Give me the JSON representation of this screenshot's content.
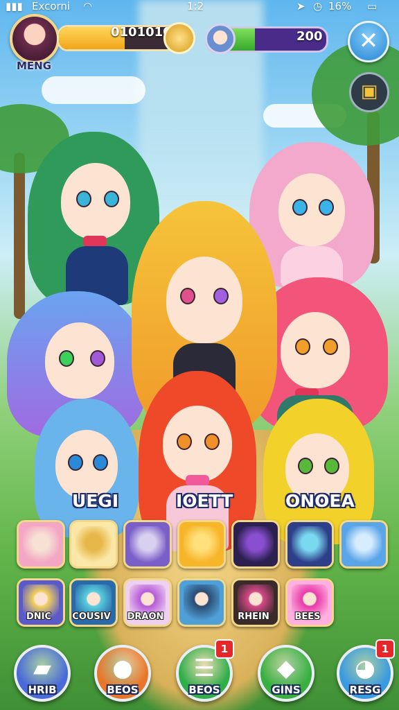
{
  "status_bar": {
    "carrier": "Excorni",
    "time": "1:2",
    "battery": "16%"
  },
  "player": {
    "name": "MENG",
    "currency": "0101010",
    "energy": "200",
    "currency_fill_fraction": 0.55,
    "energy_fill_fraction": 0.4
  },
  "team_labels": [
    "UEGI",
    "IOETT",
    "ONOEA"
  ],
  "item_row_1": [
    {
      "icon": "pink-hair-character-icon",
      "colors": [
        "#f3a7c4",
        "#f7e0d4"
      ]
    },
    {
      "icon": "hammer-tool-icon",
      "colors": [
        "#fbe8a8",
        "#e6b84a"
      ]
    },
    {
      "icon": "silver-hair-character-icon",
      "colors": [
        "#7b5fc8",
        "#d8d0f0"
      ]
    },
    {
      "icon": "gold-wing-emblem-icon",
      "colors": [
        "#f7b52a",
        "#ffe07a"
      ]
    },
    {
      "icon": "purple-sword-icon",
      "colors": [
        "#2b2050",
        "#8a4fd0"
      ]
    },
    {
      "icon": "crystal-blade-icon",
      "colors": [
        "#2e3f8a",
        "#7ad9f0"
      ]
    },
    {
      "icon": "cloud-gauntlet-icon",
      "colors": [
        "#5aa5e8",
        "#d6ecff"
      ]
    }
  ],
  "item_row_2": [
    {
      "icon": "blonde-character-icon",
      "caption": "DNIC",
      "colors": [
        "#f5d35a",
        "#5a5ac8"
      ]
    },
    {
      "icon": "cyan-character-icon",
      "caption": "COUSIV",
      "colors": [
        "#5ad0e0",
        "#2a6aa8"
      ]
    },
    {
      "icon": "violet-character-icon",
      "caption": "DRAON",
      "colors": [
        "#b45ad8",
        "#f0d0f0"
      ]
    },
    {
      "icon": "blue-helmet-icon",
      "caption": "",
      "colors": [
        "#2a4a70",
        "#4fa0d8"
      ]
    },
    {
      "icon": "dark-hair-character-icon",
      "caption": "RHEIN",
      "colors": [
        "#d84a8a",
        "#3a2a2a"
      ]
    },
    {
      "icon": "pink-orb-icon",
      "caption": "BEES",
      "colors": [
        "#e83aa8",
        "#ffb0e0"
      ]
    }
  ],
  "nav": [
    {
      "label": "HRIB",
      "icon": "stack-cards-icon",
      "color": "#4a6ad8",
      "badge": ""
    },
    {
      "label": "BEOS",
      "icon": "orange-beast-icon",
      "color": "#e8762a",
      "badge": ""
    },
    {
      "label": "BEOS",
      "icon": "list-menu-icon",
      "color": "#2fae4a",
      "badge": "1"
    },
    {
      "label": "GINS",
      "icon": "yellow-pet-icon",
      "color": "#38b040",
      "badge": ""
    },
    {
      "label": "RESG",
      "icon": "blue-slime-icon",
      "color": "#3a9ae0",
      "badge": "1"
    }
  ],
  "colors": {
    "accent_gold": "#f3d889",
    "hud_navy": "#1f2d6a"
  }
}
